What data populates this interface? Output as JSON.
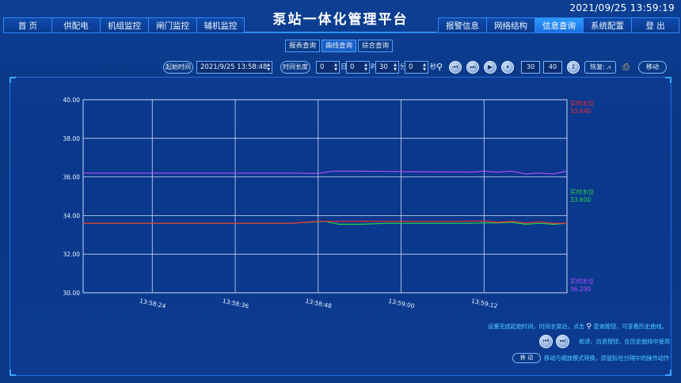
{
  "header": {
    "title": "泵站一体化管理平台",
    "clock": "2021/09/25 13:59:19",
    "nav_left": [
      "首 页",
      "供配电",
      "机组监控",
      "闸门监控",
      "辅机监控"
    ],
    "nav_right": [
      "报警信息",
      "网络结构",
      "信息查询",
      "系统配置",
      "登 出"
    ],
    "active_right": "信息查询"
  },
  "subtabs": [
    "报表查询",
    "曲线查询",
    "综合查询"
  ],
  "active_subtab": "曲线查询",
  "toolbar": {
    "start_label": "起始时间",
    "start_value": "2021/9/25 13:58:48",
    "duration_label": "时间长度",
    "day_value": "0",
    "day_unit": "日",
    "hour_value": "0",
    "hour_unit": "时",
    "minute_value": "30",
    "minute_unit": "分",
    "second_value": "0",
    "second_unit": "秒",
    "num1": "30",
    "num2": "40",
    "restore_label": "恢复:",
    "move_label": "移动"
  },
  "chart_data": {
    "type": "line",
    "ylim": [
      30,
      40
    ],
    "yticks": [
      "40.00",
      "38.00",
      "36.00",
      "34.00",
      "32.00",
      "30.00"
    ],
    "xticks": [
      "13:58:24",
      "13:58:36",
      "13:58:48",
      "13:59:00",
      "13:59:12"
    ],
    "series": [
      {
        "name": "实时水位",
        "label": "实时水位",
        "value_label": "33.600",
        "color": "#29d84a",
        "x": [
          "13:58:14",
          "13:58:30",
          "13:58:44",
          "13:58:49",
          "13:58:51",
          "13:58:54",
          "13:58:58",
          "13:59:02",
          "13:59:06",
          "13:59:10",
          "13:59:12",
          "13:59:14",
          "13:59:16",
          "13:59:18",
          "13:59:20",
          "13:59:22",
          "13:59:24"
        ],
        "values": [
          33.6,
          33.6,
          33.6,
          33.7,
          33.55,
          33.55,
          33.6,
          33.6,
          33.6,
          33.6,
          33.62,
          33.62,
          33.65,
          33.55,
          33.6,
          33.55,
          33.6
        ]
      },
      {
        "name": "实时水位",
        "label": "实时水位",
        "value_label": "33.640",
        "color": "#ff2a2a",
        "x": [
          "13:58:14",
          "13:58:30",
          "13:58:44",
          "13:58:48",
          "13:58:52",
          "13:59:00",
          "13:59:08",
          "13:59:12",
          "13:59:14",
          "13:59:16",
          "13:59:18",
          "13:59:20",
          "13:59:22",
          "13:59:24"
        ],
        "values": [
          33.6,
          33.6,
          33.6,
          33.7,
          33.7,
          33.7,
          33.7,
          33.72,
          33.65,
          33.7,
          33.62,
          33.68,
          33.6,
          33.6
        ]
      },
      {
        "name": "实时水位",
        "label": "实时水位",
        "value_label": "36.290",
        "color": "#b44cff",
        "x": [
          "13:58:14",
          "13:58:30",
          "13:58:44",
          "13:58:48",
          "13:58:50",
          "13:58:54",
          "13:59:00",
          "13:59:10",
          "13:59:12",
          "13:59:14",
          "13:59:16",
          "13:59:18",
          "13:59:20",
          "13:59:22",
          "13:59:24"
        ],
        "values": [
          36.2,
          36.2,
          36.2,
          36.18,
          36.3,
          36.3,
          36.28,
          36.25,
          36.3,
          36.25,
          36.3,
          36.15,
          36.2,
          36.15,
          36.3
        ]
      }
    ],
    "xlim": [
      "13:58:14",
      "13:59:24"
    ],
    "grid": true
  },
  "info": {
    "line1_a": "设置完成起始时间，时间长度后，点击",
    "line1_b": "查询按钮，可查看历史曲线。",
    "line2": "前进、后退按钮，在历史曲线中使用",
    "line3_btn": "移 动",
    "line3": "移动与缩放模式转换，即鼠标在分隔中的操作动作"
  },
  "colors": {
    "accent": "#2d86ff",
    "active_nav": "#2d9bff",
    "info_text": "#4fd2ff"
  }
}
